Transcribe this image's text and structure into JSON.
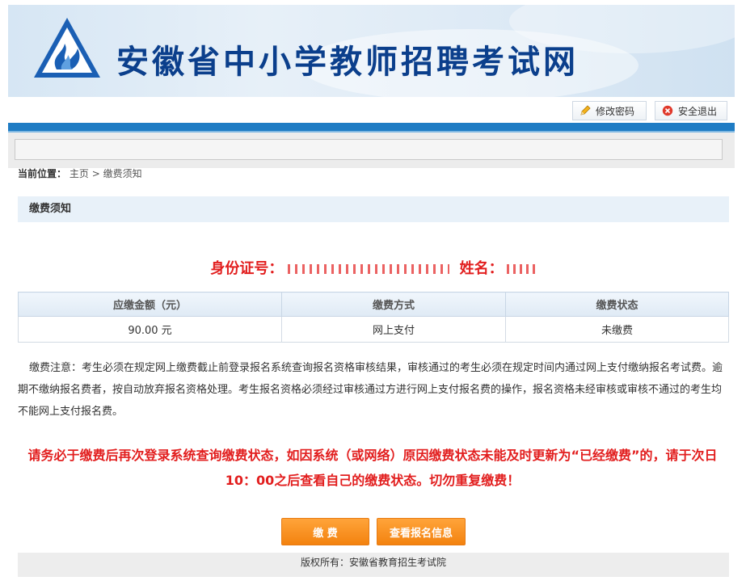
{
  "header": {
    "site_title": "安徽省中小学教师招聘考试网",
    "logo_icon": "triangle-flame-logo"
  },
  "toolbar": {
    "change_password": "修改密码",
    "change_password_icon": "pencil-icon",
    "logout": "安全退出",
    "logout_icon": "close-circle-icon"
  },
  "breadcrumb": {
    "label": "当前位置：",
    "home": "主页",
    "separator": ">",
    "current": "缴费须知"
  },
  "section": {
    "title": "缴费须知"
  },
  "candidate": {
    "id_label": "身份证号：",
    "name_label": "姓名："
  },
  "table": {
    "headers": [
      "应缴金额（元）",
      "缴费方式",
      "缴费状态"
    ],
    "row": [
      "90.00 元",
      "网上支付",
      "未缴费"
    ]
  },
  "notice": "缴费注意：考生必须在规定网上缴费截止前登录报名系统查询报名资格审核结果，审核通过的考生必须在规定时间内通过网上支付缴纳报名考试费。逾期不缴纳报名费者，按自动放弃报名资格处理。考生报名资格必须经过审核通过方进行网上支付报名费的操作，报名资格未经审核或审核不通过的考生均不能网上支付报名费。",
  "warning": "请务必于缴费后再次登录系统查询缴费状态，如因系统（或网络）原因缴费状态未能及时更新为“已经缴费”的，请于次日10：00之后查看自己的缴费状态。切勿重复缴费！",
  "buttons": {
    "pay": "缴 费",
    "view_info": "查看报名信息"
  },
  "footer": {
    "copyright": "版权所有：安徽省教育招生考试院"
  },
  "colors": {
    "brand_blue": "#1f7cc4",
    "title_blue": "#0b3f8c",
    "warning_red": "#e21e1e",
    "button_orange": "#f3820f"
  }
}
